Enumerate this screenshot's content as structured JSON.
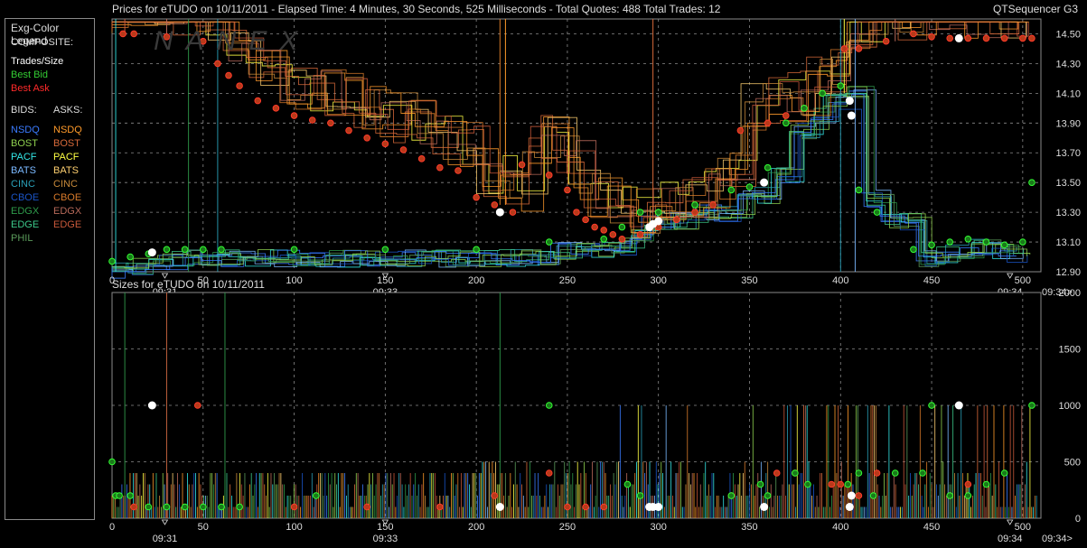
{
  "legend": {
    "title": "Exg-Color Legend",
    "composite_label": "COMPOSITE:",
    "composite": [
      {
        "label": "Trades/Size",
        "color": "#ffffff"
      },
      {
        "label": "Best Bid",
        "color": "#33cc33"
      },
      {
        "label": "Best Ask",
        "color": "#ff2a2a"
      }
    ],
    "bids_label": "BIDS:",
    "asks_label": "ASKS:",
    "bids": [
      {
        "label": "NSDQ",
        "color": "#3a7bff"
      },
      {
        "label": "BOST",
        "color": "#8fd14f"
      },
      {
        "label": "PACF",
        "color": "#33e6e6"
      },
      {
        "label": "BATS",
        "color": "#7ab8ff"
      },
      {
        "label": "CINC",
        "color": "#2aa0b8"
      },
      {
        "label": "CBOE",
        "color": "#1a55c8"
      },
      {
        "label": "EDGX",
        "color": "#2e9a4a"
      },
      {
        "label": "EDGE",
        "color": "#3cc88a"
      },
      {
        "label": "PHIL",
        "color": "#5a9a5a"
      }
    ],
    "asks": [
      {
        "label": "NSDQ",
        "color": "#ff9a2a"
      },
      {
        "label": "BOST",
        "color": "#d86a3a"
      },
      {
        "label": "PACF",
        "color": "#ffff44"
      },
      {
        "label": "BATS",
        "color": "#ffd070"
      },
      {
        "label": "CINC",
        "color": "#c88a3a"
      },
      {
        "label": "CBOE",
        "color": "#d87a2a"
      },
      {
        "label": "EDGX",
        "color": "#b86a5a"
      },
      {
        "label": "EDGE",
        "color": "#c8583a"
      }
    ]
  },
  "header": {
    "title": "Prices for  eTUDO  on  10/11/2011  - Elapsed Time: 4 Minutes, 30 Seconds, 525 Milliseconds  - Total Quotes: 488  Total Trades: 12",
    "app": "QTSequencer G3",
    "sizes_title": "Sizes for  eTUDO  on  10/11/2011"
  },
  "watermark": "NANEX",
  "colors": {
    "bid": "#33cc33",
    "ask": "#ff2a2a",
    "trade": "#ffffff",
    "grid": "#8a8a8a",
    "frame": "#8a8a8a"
  },
  "chart_data": [
    {
      "type": "line",
      "name": "prices",
      "xlim": [
        0,
        510
      ],
      "ylim": [
        12.9,
        14.6
      ],
      "x_ticks": [
        0,
        50,
        100,
        150,
        200,
        250,
        300,
        350,
        400,
        450,
        500
      ],
      "x_tick_labels": [
        "0",
        "50",
        "100",
        "150",
        "200",
        "250",
        "300",
        "350",
        "400",
        "450",
        "500"
      ],
      "y_ticks": [
        12.9,
        13.1,
        13.3,
        13.5,
        13.7,
        13.9,
        14.1,
        14.3,
        14.5
      ],
      "y_tick_labels": [
        "12.90",
        "13.10",
        "13.30",
        "13.50",
        "13.70",
        "13.90",
        "14.10",
        "14.30",
        "14.50"
      ],
      "time_markers": [
        {
          "x": 29,
          "label": "09:31"
        },
        {
          "x": 150,
          "label": "09:33"
        },
        {
          "x": 493,
          "label": "09:34"
        }
      ],
      "end_label": "09:34>",
      "grid": true,
      "series": [
        {
          "name": "Best Ask",
          "x": [
            6,
            12,
            30,
            50,
            58,
            64,
            70,
            80,
            90,
            100,
            110,
            120,
            130,
            140,
            150,
            160,
            170,
            180,
            190,
            200,
            210,
            220,
            225,
            240,
            250,
            255,
            260,
            265,
            270,
            275,
            280,
            290,
            300,
            310,
            320,
            330,
            345,
            360,
            370,
            380,
            390,
            402,
            410,
            425,
            440,
            450,
            460,
            470,
            480,
            490,
            500,
            505
          ],
          "y": [
            14.5,
            14.5,
            14.48,
            14.45,
            14.3,
            14.22,
            14.15,
            14.05,
            14.0,
            13.95,
            13.92,
            13.9,
            13.85,
            13.8,
            13.76,
            13.72,
            13.66,
            13.6,
            13.58,
            13.4,
            13.35,
            13.3,
            13.62,
            13.55,
            13.45,
            13.3,
            13.25,
            13.2,
            13.18,
            13.15,
            13.12,
            13.15,
            13.2,
            13.25,
            13.3,
            13.35,
            13.85,
            13.9,
            13.95,
            14.0,
            14.1,
            14.4,
            14.4,
            14.45,
            14.5,
            14.48,
            14.47,
            14.47,
            14.47,
            14.47,
            14.47,
            14.47
          ]
        },
        {
          "name": "Best Bid",
          "x": [
            0,
            10,
            20,
            30,
            40,
            50,
            60,
            100,
            150,
            200,
            240,
            270,
            280,
            290,
            300,
            320,
            340,
            350,
            360,
            370,
            380,
            390,
            400,
            410,
            420,
            440,
            450,
            460,
            470,
            480,
            490,
            500,
            505
          ],
          "y": [
            12.97,
            13.0,
            13.02,
            13.05,
            13.05,
            13.05,
            13.05,
            13.05,
            13.05,
            13.05,
            13.1,
            13.12,
            13.2,
            13.3,
            13.3,
            13.35,
            13.45,
            13.47,
            13.6,
            13.9,
            14.0,
            14.1,
            14.15,
            13.45,
            13.3,
            13.05,
            13.08,
            13.1,
            13.12,
            13.1,
            13.08,
            13.1,
            13.5
          ]
        }
      ],
      "trades": {
        "x": [
          22,
          213,
          295,
          297,
          300,
          358,
          405,
          406,
          465
        ],
        "y": [
          13.03,
          13.3,
          13.2,
          13.22,
          13.24,
          13.5,
          14.05,
          13.95,
          14.47
        ]
      }
    },
    {
      "type": "bar",
      "name": "sizes",
      "xlim": [
        0,
        510
      ],
      "ylim": [
        0,
        2000
      ],
      "x_ticks": [
        0,
        50,
        100,
        150,
        200,
        250,
        300,
        350,
        400,
        450,
        500
      ],
      "x_tick_labels": [
        "0",
        "50",
        "100",
        "150",
        "200",
        "250",
        "300",
        "350",
        "400",
        "450",
        "500"
      ],
      "y_ticks": [
        0,
        500,
        1000,
        1500,
        2000
      ],
      "y_tick_labels": [
        "0",
        "500",
        "1000",
        "1500",
        "2000"
      ],
      "time_markers": [
        {
          "x": 29,
          "label": "09:31"
        },
        {
          "x": 150,
          "label": "09:33"
        },
        {
          "x": 493,
          "label": "09:34"
        }
      ],
      "end_label": "09:34>",
      "grid": true,
      "trades": {
        "x": [
          22,
          213,
          295,
          297,
          300,
          358,
          405,
          406,
          465
        ],
        "y": [
          1000,
          100,
          100,
          100,
          100,
          100,
          100,
          200,
          1000
        ]
      },
      "bids": {
        "x": [
          0,
          2,
          4,
          10,
          20,
          30,
          40,
          50,
          60,
          70,
          112,
          240,
          283,
          290,
          297,
          340,
          356,
          360,
          375,
          382,
          404,
          410,
          418,
          430,
          445,
          450,
          460,
          470,
          480,
          490,
          505
        ],
        "y": [
          500,
          200,
          200,
          200,
          100,
          100,
          100,
          100,
          100,
          100,
          200,
          1000,
          300,
          200,
          100,
          200,
          300,
          200,
          400,
          300,
          300,
          400,
          200,
          400,
          400,
          1000,
          200,
          200,
          300,
          400,
          1000
        ]
      },
      "asks": {
        "x": [
          12,
          47,
          100,
          140,
          180,
          210,
          240,
          250,
          260,
          270,
          300,
          340,
          365,
          375,
          395,
          400,
          410,
          420,
          460,
          470
        ],
        "y": [
          100,
          1000,
          100,
          100,
          100,
          200,
          400,
          100,
          100,
          100,
          100,
          200,
          400,
          400,
          300,
          300,
          200,
          400,
          200,
          300
        ]
      }
    }
  ]
}
